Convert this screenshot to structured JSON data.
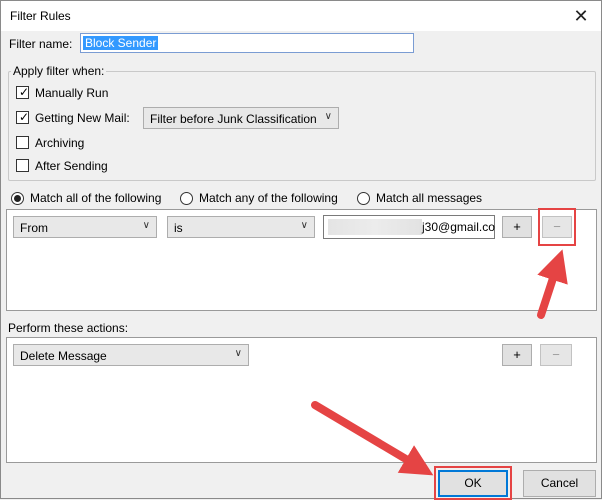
{
  "window": {
    "title": "Filter Rules",
    "close_glyph": "✕"
  },
  "filter_name": {
    "label": "Filter name:",
    "value": "Block Sender"
  },
  "apply_when": {
    "legend": "Apply filter when:",
    "manually_run": {
      "label": "Manually Run",
      "checked": true
    },
    "getting_new_mail": {
      "label": "Getting New Mail:",
      "checked": true,
      "option": "Filter before Junk Classification"
    },
    "archiving": {
      "label": "Archiving",
      "checked": false
    },
    "after_sending": {
      "label": "After Sending",
      "checked": false
    }
  },
  "match": {
    "all": "Match all of the following",
    "any": "Match any of the following",
    "all_messages": "Match all messages",
    "selected": "all"
  },
  "rule": {
    "field": "From",
    "operator": "is",
    "value": "j30@gmail.co",
    "add_label": "+",
    "remove_label": "−"
  },
  "actions": {
    "legend": "Perform these actions:",
    "action": "Delete Message",
    "add_label": "+",
    "remove_label": "−"
  },
  "buttons": {
    "ok": "OK",
    "cancel": "Cancel"
  },
  "icons": {
    "dropdown": "chevron-down-icon",
    "check": "✓"
  },
  "colors": {
    "annotation_red": "#e54444",
    "selection_blue": "#3399ff",
    "default_button_border": "#0078d7"
  }
}
